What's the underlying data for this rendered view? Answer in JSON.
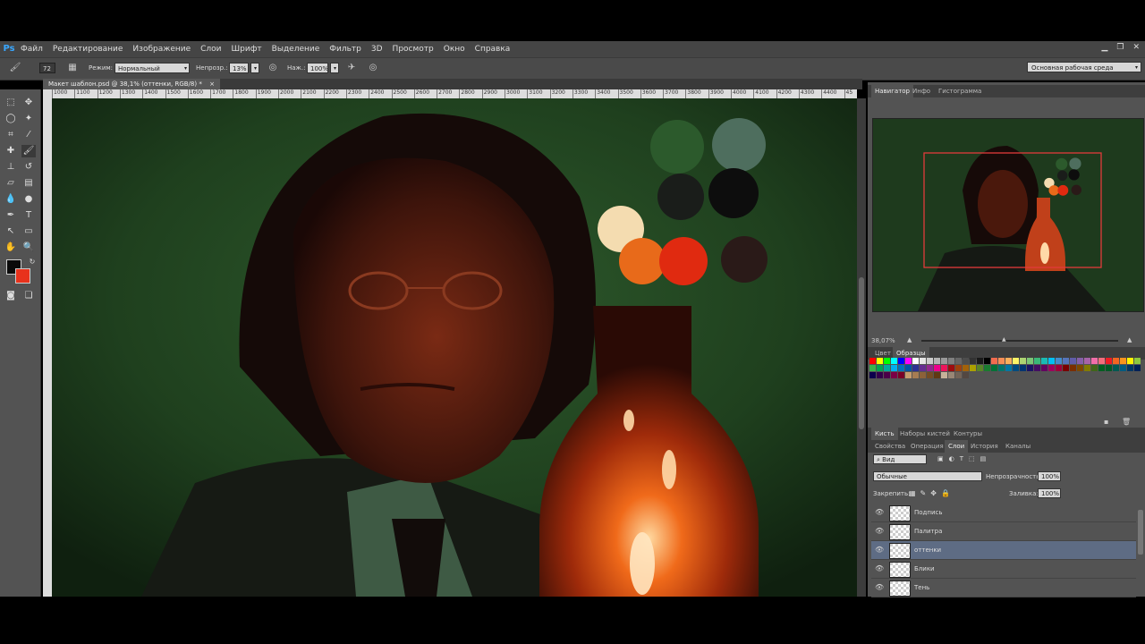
{
  "menu": {
    "logo": "Ps",
    "items": [
      "Файл",
      "Редактирование",
      "Изображение",
      "Слои",
      "Шрифт",
      "Выделение",
      "Фильтр",
      "3D",
      "Просмотр",
      "Окно",
      "Справка"
    ],
    "window_controls": [
      "▁",
      "❐",
      "✕"
    ]
  },
  "options": {
    "brush_size": "72",
    "mode_label": "Режим:",
    "mode_value": "Нормальный",
    "opacity_label": "Непрозр.:",
    "opacity_value": "13%",
    "pressure_label": "Наж.:",
    "pressure_value": "100%",
    "workspace": "Основная рабочая среда"
  },
  "document": {
    "tab_title": "Макет шаблон.psd @ 38,1% (оттенки, RGB/8) *",
    "tab_close": "×"
  },
  "ruler": {
    "ticks": [
      "1000",
      "1100",
      "1200",
      "1300",
      "1400",
      "1500",
      "1600",
      "1700",
      "1800",
      "1900",
      "2000",
      "2100",
      "2200",
      "2300",
      "2400",
      "2500",
      "2600",
      "2700",
      "2800",
      "2900",
      "3000",
      "3100",
      "3200",
      "3300",
      "3400",
      "3500",
      "3600",
      "3700",
      "3800",
      "3900",
      "4000",
      "4100",
      "4200",
      "4300",
      "4400",
      "45"
    ]
  },
  "navigator": {
    "tabs": [
      "Навигатор",
      "Инфо",
      "Гистограмма"
    ],
    "zoom": "38,07%"
  },
  "color_panel": {
    "tabs": [
      "Цвет",
      "Образцы"
    ]
  },
  "brush_panel": {
    "tabs": [
      "Кисть",
      "Наборы кистей",
      "Контуры"
    ]
  },
  "layers_panel": {
    "tabs": [
      "Свойства",
      "Операция",
      "Слои",
      "История",
      "Каналы"
    ],
    "filter_value": "Вид",
    "blend_mode": "Обычные",
    "opacity_label": "Непрозрачность:",
    "opacity_value": "100%",
    "lock_label": "Закрепить:",
    "fill_label": "Заливка:",
    "fill_value": "100%",
    "layers": [
      {
        "name": "Подпись",
        "selected": false
      },
      {
        "name": "Палитра",
        "selected": false
      },
      {
        "name": "оттенки",
        "selected": true
      },
      {
        "name": "Блики",
        "selected": false
      },
      {
        "name": "Тень",
        "selected": false
      }
    ]
  },
  "colors": {
    "foreground": "#0a0a0a",
    "background": "#e8321c",
    "palette": [
      "#2c5a2c",
      "#4e6e5e",
      "#1a1d1a",
      "#0d0d0d",
      "#f4dcb0",
      "#e86a1a",
      "#e02a10",
      "#2a1a18"
    ],
    "swatches": [
      "#ff0000",
      "#ffff00",
      "#00ff00",
      "#00ffff",
      "#0000ff",
      "#ff00ff",
      "#ffffff",
      "#e6e6e6",
      "#cccccc",
      "#b3b3b3",
      "#999999",
      "#808080",
      "#666666",
      "#4d4d4d",
      "#333333",
      "#1a1a1a",
      "#000000",
      "#f26c4f",
      "#f68e56",
      "#fbaf5c",
      "#fff467",
      "#acd372",
      "#7cc576",
      "#3bb878",
      "#1abbb4",
      "#00bff3",
      "#438ccb",
      "#5574b9",
      "#605ca8",
      "#855fa8",
      "#a763a8",
      "#f06ea9",
      "#f26d7d",
      "#ed1c24",
      "#f26522",
      "#f7941d",
      "#fff200",
      "#8dc73f",
      "#39b54a",
      "#00a651",
      "#00a99d",
      "#00aeef",
      "#0072bc",
      "#0054a6",
      "#2e3192",
      "#662d91",
      "#92278f",
      "#ec008c",
      "#ed145b",
      "#9e0b0f",
      "#a0410d",
      "#a36209",
      "#aba000",
      "#598527",
      "#1a7b30",
      "#007236",
      "#00746b",
      "#0076a3",
      "#004b80",
      "#003471",
      "#1b1464",
      "#440e62",
      "#630460",
      "#9e005d",
      "#9e0039",
      "#790000",
      "#7b2e00",
      "#7d4900",
      "#827b00",
      "#406618",
      "#005e20",
      "#005826",
      "#005952",
      "#005b7f",
      "#003663",
      "#002157",
      "#0d004c",
      "#32004b",
      "#4b0049",
      "#7b0046",
      "#7a0026",
      "#c69c6d",
      "#a67c52",
      "#8c6239",
      "#754c24",
      "#603913",
      "#c7b299",
      "#998675",
      "#736357",
      "#534741"
    ]
  }
}
